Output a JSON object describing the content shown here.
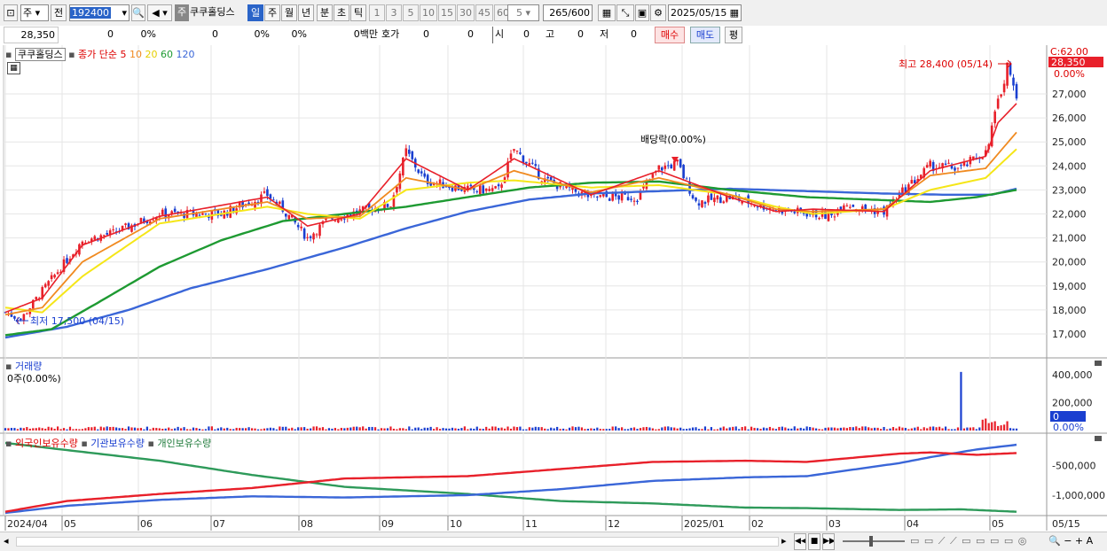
{
  "toolbar": {
    "period_label": "주",
    "prev_label": "전",
    "code": "192400",
    "stock_tag": "주",
    "stock_name": "쿠쿠홀딩스",
    "periods": [
      "일",
      "주",
      "월",
      "년",
      "분",
      "초",
      "틱"
    ],
    "active_period": "일",
    "intervals": [
      "1",
      "3",
      "5",
      "10",
      "15",
      "30",
      "45",
      "60"
    ],
    "interval_value": "5",
    "count": "265",
    "count_total": "/600",
    "date": "2025/05/15"
  },
  "quote": {
    "price": "28,350",
    "change": "0",
    "change_pct": "0%",
    "volume": "0",
    "vol_pct1": "0%",
    "vol_pct2": "0%",
    "amount": "0백만",
    "hoga_label": "호가",
    "hoga_v1": "0",
    "hoga_v2": "0",
    "open_label": "시",
    "open_value": "0",
    "high_label": "고",
    "high_value": "0",
    "low_label": "저",
    "low_value": "0",
    "buy_label": "매수",
    "sell_label": "매도",
    "avg_label": "평"
  },
  "colors": {
    "up": "#e8202a",
    "down": "#1a3fd0",
    "ma5": "#e8202a",
    "ma10": "#f08a20",
    "ma20": "#f5e618",
    "ma60": "#1e9a32",
    "ma120": "#3a66d8",
    "foreign": "#e8202a",
    "inst": "#3a66d8",
    "indiv": "#2e9a5a"
  },
  "legend": {
    "name": "쿠쿠홀딩스",
    "ma_prefix": "종가 단순",
    "ma_periods": [
      "5",
      "10",
      "20",
      "60",
      "120"
    ]
  },
  "annotations": {
    "high": "최고 28,400 (05/14)",
    "low": "최저 17,500 (04/15)",
    "dividend": "배당락(0.00%)"
  },
  "price_axis": {
    "ticks": [
      "27,000",
      "26,000",
      "25,000",
      "24,000",
      "23,000",
      "22,000",
      "21,000",
      "20,000",
      "19,000",
      "18,000",
      "17,000"
    ],
    "c_label": "C:62.00",
    "current_badge": "28,350",
    "current_pct": "0.00%"
  },
  "volume_pane": {
    "title": "거래량",
    "value_text": "0주(0.00%)",
    "ticks": [
      "400,000",
      "200,000"
    ],
    "badge": "0",
    "pct": "0.00%"
  },
  "holdings_pane": {
    "legend": [
      "외국인보유수량",
      "기관보유수량",
      "개인보유수량"
    ],
    "ticks": [
      "-500,000",
      "-1,000,000"
    ]
  },
  "x_axis": {
    "labels": [
      "2024/04",
      "05",
      "06",
      "07",
      "08",
      "09",
      "10",
      "11",
      "12",
      "2025/01",
      "02",
      "03",
      "04",
      "05"
    ],
    "end_label": "05/15"
  },
  "chart_data": {
    "type": "candlestick",
    "days": 265,
    "start": "2024/04/01",
    "end": "2025/05/15",
    "price_range": [
      16500,
      28600
    ],
    "close_anchors": [
      [
        0,
        17900
      ],
      [
        5,
        17600
      ],
      [
        12,
        18800
      ],
      [
        25,
        20900
      ],
      [
        35,
        21200
      ],
      [
        50,
        22000
      ],
      [
        70,
        22000
      ],
      [
        85,
        22800
      ],
      [
        90,
        22200
      ],
      [
        98,
        21000
      ],
      [
        105,
        21800
      ],
      [
        115,
        22100
      ],
      [
        125,
        22400
      ],
      [
        130,
        24600
      ],
      [
        136,
        23400
      ],
      [
        150,
        23000
      ],
      [
        160,
        23000
      ],
      [
        165,
        24700
      ],
      [
        175,
        23400
      ],
      [
        190,
        22700
      ],
      [
        205,
        22700
      ],
      [
        212,
        23900
      ],
      [
        218,
        24100
      ],
      [
        224,
        22500
      ],
      [
        235,
        22700
      ],
      [
        250,
        22200
      ],
      [
        262,
        22000
      ],
      [
        268,
        21900
      ],
      [
        272,
        22500
      ],
      [
        278,
        22200
      ],
      [
        285,
        22100
      ],
      [
        290,
        22800
      ],
      [
        300,
        24000
      ],
      [
        310,
        23900
      ],
      [
        318,
        24600
      ],
      [
        322,
        26600
      ],
      [
        325,
        28200
      ],
      [
        328,
        26800
      ]
    ],
    "ma_anchors": {
      "ma5": [
        [
          0,
          17900
        ],
        [
          12,
          18500
        ],
        [
          25,
          20700
        ],
        [
          50,
          21900
        ],
        [
          85,
          22700
        ],
        [
          98,
          21500
        ],
        [
          115,
          22000
        ],
        [
          130,
          24300
        ],
        [
          150,
          23000
        ],
        [
          165,
          24300
        ],
        [
          190,
          22800
        ],
        [
          212,
          23800
        ],
        [
          235,
          22700
        ],
        [
          250,
          22100
        ],
        [
          262,
          22200
        ],
        [
          285,
          22100
        ],
        [
          300,
          23800
        ],
        [
          318,
          24400
        ],
        [
          322,
          25800
        ],
        [
          328,
          26600
        ]
      ],
      "ma10": [
        [
          0,
          17800
        ],
        [
          12,
          18100
        ],
        [
          25,
          20000
        ],
        [
          50,
          21800
        ],
        [
          85,
          22500
        ],
        [
          98,
          21800
        ],
        [
          115,
          21900
        ],
        [
          130,
          23500
        ],
        [
          150,
          23000
        ],
        [
          165,
          23800
        ],
        [
          190,
          22900
        ],
        [
          212,
          23500
        ],
        [
          235,
          22800
        ],
        [
          250,
          22200
        ],
        [
          262,
          22100
        ],
        [
          285,
          22200
        ],
        [
          300,
          23600
        ],
        [
          318,
          23900
        ],
        [
          328,
          25400
        ]
      ],
      "ma20": [
        [
          0,
          18100
        ],
        [
          12,
          17900
        ],
        [
          25,
          19400
        ],
        [
          50,
          21600
        ],
        [
          85,
          22300
        ],
        [
          98,
          22000
        ],
        [
          115,
          21800
        ],
        [
          130,
          23000
        ],
        [
          150,
          23300
        ],
        [
          165,
          23400
        ],
        [
          190,
          23100
        ],
        [
          212,
          23200
        ],
        [
          235,
          22800
        ],
        [
          250,
          22300
        ],
        [
          262,
          22000
        ],
        [
          285,
          22200
        ],
        [
          300,
          23000
        ],
        [
          318,
          23500
        ],
        [
          328,
          24700
        ]
      ],
      "ma60": [
        [
          0,
          16950
        ],
        [
          15,
          17200
        ],
        [
          30,
          18300
        ],
        [
          50,
          19800
        ],
        [
          70,
          20900
        ],
        [
          90,
          21700
        ],
        [
          110,
          22000
        ],
        [
          130,
          22300
        ],
        [
          150,
          22700
        ],
        [
          170,
          23100
        ],
        [
          190,
          23300
        ],
        [
          212,
          23350
        ],
        [
          235,
          23000
        ],
        [
          260,
          22700
        ],
        [
          280,
          22600
        ],
        [
          300,
          22500
        ],
        [
          315,
          22700
        ],
        [
          328,
          23000
        ]
      ],
      "ma120": [
        [
          0,
          16850
        ],
        [
          20,
          17300
        ],
        [
          40,
          18000
        ],
        [
          60,
          18900
        ],
        [
          85,
          19700
        ],
        [
          110,
          20600
        ],
        [
          130,
          21400
        ],
        [
          150,
          22100
        ],
        [
          170,
          22600
        ],
        [
          190,
          22850
        ],
        [
          212,
          22950
        ],
        [
          235,
          23050
        ],
        [
          260,
          22950
        ],
        [
          285,
          22850
        ],
        [
          305,
          22800
        ],
        [
          320,
          22800
        ],
        [
          328,
          23050
        ]
      ]
    },
    "volume_range": [
      0,
      450000
    ],
    "volume_spike": {
      "day": 310,
      "value": 420000
    },
    "holdings_range": [
      -1300000,
      0
    ],
    "holdings_anchors": {
      "foreign": [
        [
          0,
          -1280000
        ],
        [
          20,
          -1100000
        ],
        [
          50,
          -980000
        ],
        [
          80,
          -880000
        ],
        [
          110,
          -720000
        ],
        [
          150,
          -680000
        ],
        [
          180,
          -560000
        ],
        [
          210,
          -440000
        ],
        [
          240,
          -420000
        ],
        [
          260,
          -440000
        ],
        [
          290,
          -300000
        ],
        [
          300,
          -280000
        ],
        [
          315,
          -320000
        ],
        [
          328,
          -290000
        ]
      ],
      "inst": [
        [
          0,
          -1300000
        ],
        [
          20,
          -1180000
        ],
        [
          50,
          -1080000
        ],
        [
          80,
          -1020000
        ],
        [
          110,
          -1040000
        ],
        [
          150,
          -1000000
        ],
        [
          180,
          -900000
        ],
        [
          210,
          -760000
        ],
        [
          240,
          -700000
        ],
        [
          260,
          -680000
        ],
        [
          290,
          -460000
        ],
        [
          300,
          -360000
        ],
        [
          315,
          -230000
        ],
        [
          328,
          -150000
        ]
      ],
      "indiv": [
        [
          0,
          -120000
        ],
        [
          20,
          -240000
        ],
        [
          50,
          -420000
        ],
        [
          80,
          -660000
        ],
        [
          110,
          -860000
        ],
        [
          150,
          -980000
        ],
        [
          180,
          -1100000
        ],
        [
          210,
          -1140000
        ],
        [
          240,
          -1210000
        ],
        [
          260,
          -1220000
        ],
        [
          290,
          -1250000
        ],
        [
          310,
          -1240000
        ],
        [
          328,
          -1280000
        ]
      ]
    }
  }
}
